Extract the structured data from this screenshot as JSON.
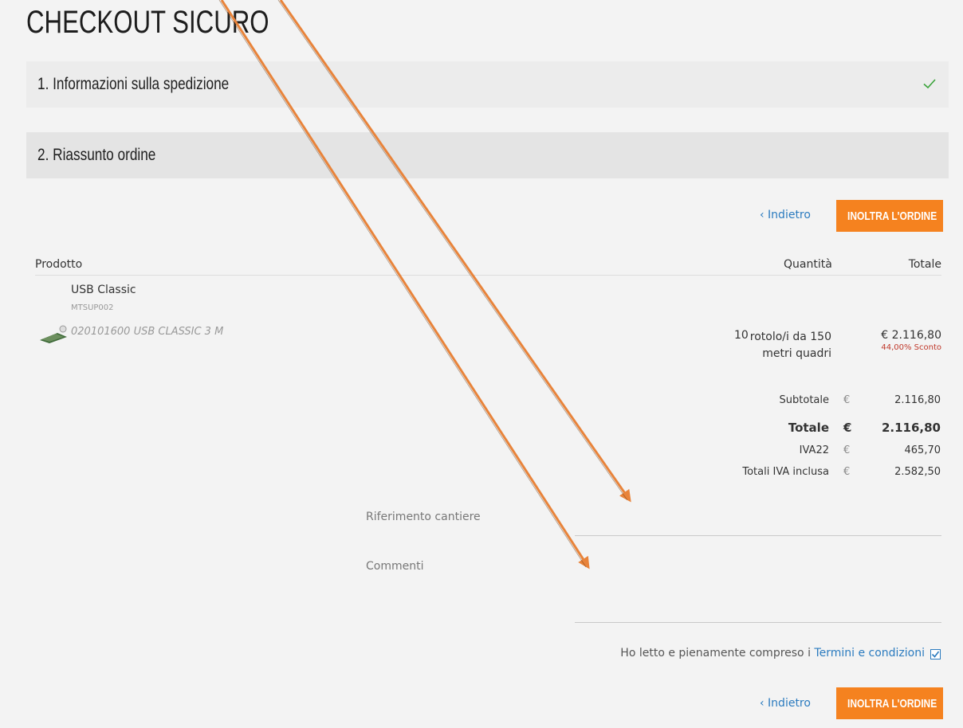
{
  "page_title": "CHECKOUT SICURO",
  "steps": [
    {
      "label": "1.  Informazioni sulla spedizione",
      "icon": "check-icon"
    },
    {
      "label": "2.  Riassunto ordine"
    }
  ],
  "actions": {
    "back_label": "‹ Indietro",
    "submit_label": "INOLTRA L'ORDINE"
  },
  "table": {
    "headers": {
      "product": "Prodotto",
      "quantity": "Quantità",
      "total": "Totale"
    },
    "item": {
      "name": "USB Classic",
      "sku": "MTSUP002",
      "variant": "020101600 USB CLASSIC 3 M",
      "icon": "product-thumbnail-icon",
      "quantity": "10",
      "unit": "rotolo/i da 150 metri quadri",
      "price": "€ 2.116,80",
      "discount": "44,00% Sconto"
    }
  },
  "summary": {
    "subtotal": {
      "label": "Subtotale",
      "currency": "€",
      "value": "2.116,80"
    },
    "total": {
      "label": "Totale",
      "currency": "€",
      "value": "2.116,80"
    },
    "vat": {
      "label": "IVA22",
      "currency": "€",
      "value": "465,70"
    },
    "total_incl_vat": {
      "label": "Totali IVA inclusa",
      "currency": "€",
      "value": "2.582,50"
    }
  },
  "fields": {
    "site_reference": {
      "label": "Riferimento cantiere",
      "value": ""
    },
    "comments": {
      "label": "Commenti",
      "value": ""
    }
  },
  "terms": {
    "text": "Ho letto e pienamente compreso i ",
    "link": "Termini e condizioni",
    "checked": true
  },
  "colors": {
    "accent": "#f5821f",
    "link": "#2b7bbf",
    "discount": "#c0392b",
    "check": "#3aa33a",
    "annotation_arrow": "#e8833a"
  }
}
